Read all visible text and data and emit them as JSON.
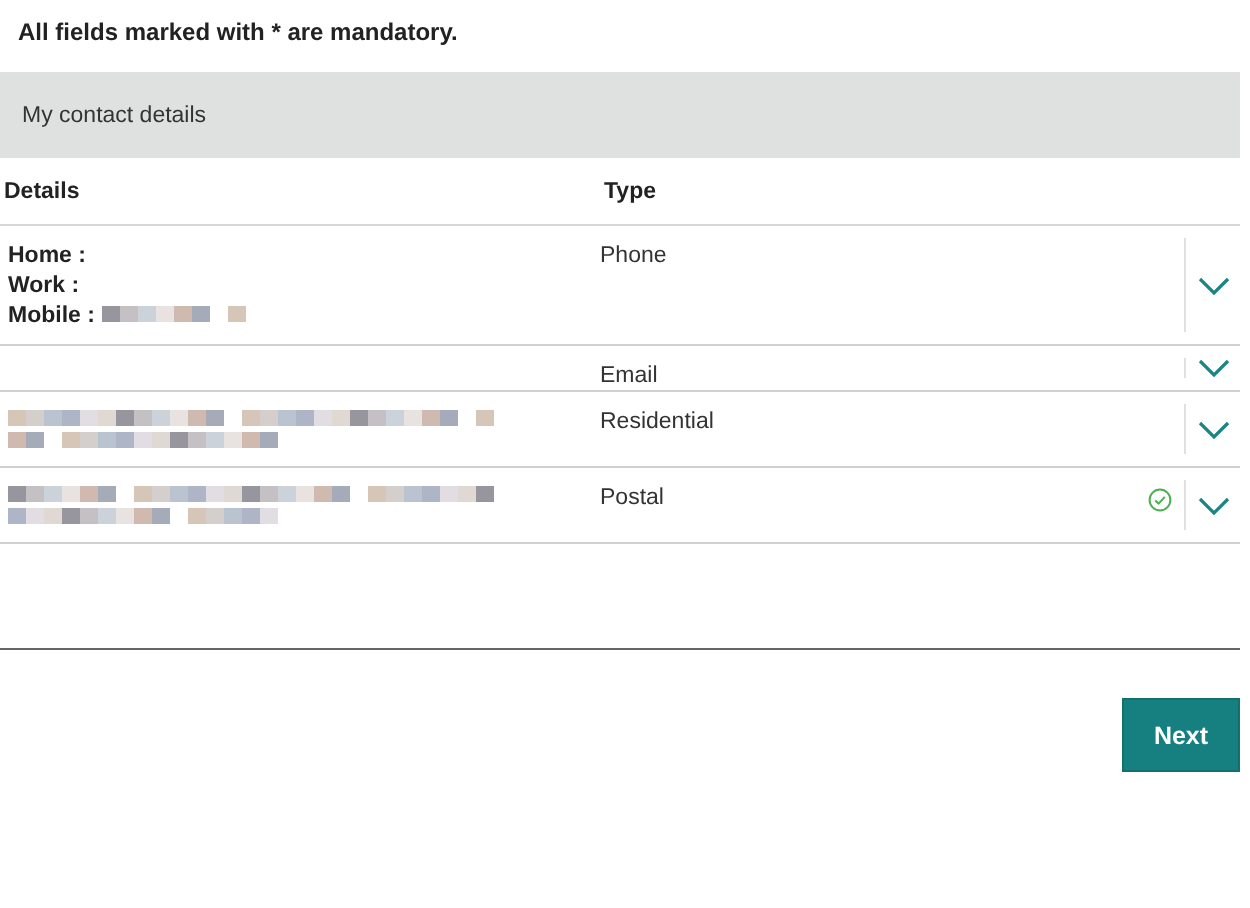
{
  "notice": "All fields marked with * are mandatory.",
  "section": {
    "title": "My contact details"
  },
  "table": {
    "columns": [
      "Details",
      "Type"
    ],
    "rows": [
      {
        "details": {
          "kind": "phone",
          "lines": [
            {
              "label": "Home :",
              "redacted": false
            },
            {
              "label": "Work :",
              "redacted": false
            },
            {
              "label": "Mobile :",
              "redacted": true
            }
          ]
        },
        "type": "Phone",
        "verified": false
      },
      {
        "details": {
          "kind": "empty"
        },
        "type": "Email",
        "verified": false
      },
      {
        "details": {
          "kind": "redacted"
        },
        "type": "Residential",
        "verified": false
      },
      {
        "details": {
          "kind": "redacted"
        },
        "type": "Postal",
        "verified": true
      }
    ]
  },
  "buttons": [
    {
      "label": "Next"
    }
  ]
}
